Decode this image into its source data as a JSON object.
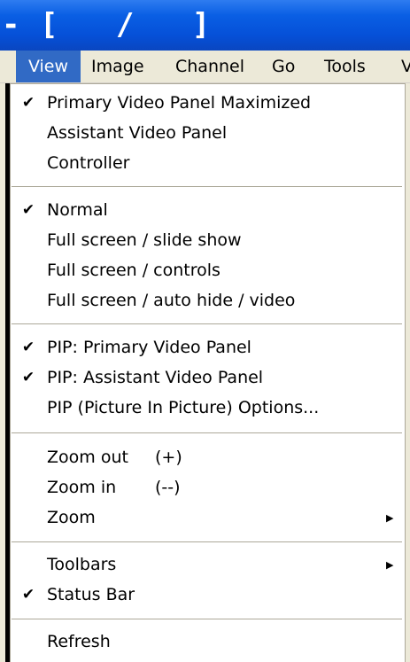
{
  "window": {
    "title": "- [   /   ]"
  },
  "menubar": {
    "items": [
      {
        "label": "View",
        "active": true
      },
      {
        "label": "Image"
      },
      {
        "label": "Channel"
      },
      {
        "label": "Go"
      },
      {
        "label": "Tools"
      },
      {
        "label": "V"
      }
    ]
  },
  "view_menu": {
    "groups": [
      {
        "items": [
          {
            "label": "Primary Video Panel Maximized",
            "checked": true
          },
          {
            "label": "Assistant Video Panel",
            "checked": false
          },
          {
            "label": "Controller",
            "checked": false
          }
        ]
      },
      {
        "items": [
          {
            "label": "Normal",
            "checked": true
          },
          {
            "label": "Full screen / slide show",
            "checked": false
          },
          {
            "label": "Full screen / controls",
            "checked": false
          },
          {
            "label": "Full screen / auto hide / video",
            "checked": false
          }
        ]
      },
      {
        "items": [
          {
            "label": "PIP: Primary Video Panel",
            "checked": true
          },
          {
            "label": "PIP: Assistant Video Panel",
            "checked": true
          },
          {
            "label": "PIP (Picture In Picture) Options...",
            "checked": false
          }
        ]
      },
      {
        "items": [
          {
            "label": "Zoom out",
            "shortcut": "(+)",
            "checked": false
          },
          {
            "label": "Zoom in",
            "shortcut": "(--)",
            "checked": false
          },
          {
            "label": "Zoom",
            "submenu": true,
            "checked": false
          }
        ]
      },
      {
        "items": [
          {
            "label": "Toolbars",
            "submenu": true,
            "checked": false
          },
          {
            "label": "Status Bar",
            "checked": true
          }
        ]
      },
      {
        "items": [
          {
            "label": "Refresh",
            "checked": false
          }
        ]
      }
    ],
    "check_glyph": "✔",
    "submenu_glyph": "▶"
  },
  "colors": {
    "titlebar": "#0550d8",
    "menu_highlight": "#316ac5",
    "menubar_bg": "#ece9d8",
    "menu_bg": "#ffffff",
    "separator": "#aca899"
  }
}
